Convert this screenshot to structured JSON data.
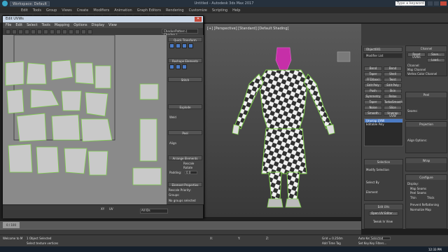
{
  "app": {
    "workspace": "Workspace: Default",
    "title": "Untitled - Autodesk 3ds Max 2017",
    "search_placeholder": "Type a keyword or phrase"
  },
  "menu": [
    "Edit",
    "Tools",
    "Group",
    "Views",
    "Create",
    "Modifiers",
    "Animation",
    "Graph Editors",
    "Rendering",
    "Customize",
    "Scripting",
    "Help"
  ],
  "unwrap": {
    "title": "Edit UVWs",
    "menu": [
      "File",
      "Edit",
      "Select",
      "Tools",
      "Mapping",
      "Options",
      "Display",
      "View"
    ],
    "checker": "CheckerPattern ( Checker )",
    "panel": {
      "quick_transform": "Quick Transform",
      "reshape": "Reshape Elements",
      "stitch": "Stitch",
      "explode": "Explode",
      "weld": "Weld",
      "peel": "Peel",
      "align": "Align",
      "arrange": "Arrange Elements",
      "rescale": "Rescale",
      "rotate": "Rotate",
      "padding": "Padding:",
      "padding_value": "0.0",
      "element_props": "Element Properties",
      "rescale_priority": "Rescale Priority:",
      "groups": "Groups:",
      "no_groups": "No groups selected"
    },
    "bottom": {
      "xy": "XY",
      "uv": "UV",
      "all_ids": "All IDs"
    }
  },
  "viewport": {
    "label": "[+] [Perspective] [Standard] [Default Shading]"
  },
  "command_panel": {
    "object_name": "Object001",
    "modifier_list": "Modifier List",
    "buttons": [
      [
        "Bend",
        "Bend"
      ],
      [
        "Taper",
        "Shell"
      ],
      [
        "FFD(box)",
        "Twist"
      ],
      [
        "Edit Poly",
        "Edit Poly"
      ],
      [
        "Push",
        "Skin"
      ],
      [
        "Symmetry",
        "Relax"
      ],
      [
        "Taper",
        "TurboSmooth"
      ],
      [
        "Noise",
        "Slice"
      ],
      [
        "Smooth",
        "Unwrap UVW"
      ]
    ],
    "stack": [
      "Unwrap UVW",
      "Editable Poly"
    ],
    "selection": "Selection",
    "modify_selection": "Modify Selection",
    "select_by": "Select By",
    "element": "Element",
    "edit_uvs": "Edit UVs",
    "open_uv_editor": "Open UV Editor ...",
    "tweak_in_view": "Tweak In View",
    "wrap": "Wrap",
    "channel": {
      "title": "Channel",
      "reset": "Reset UVWs",
      "save": "Save...",
      "load": "Load...",
      "channel_label": "Channel:",
      "map": "Map Channel",
      "vertex": "Vertex Color Channel"
    },
    "peel": {
      "title": "Peel",
      "seams": "Seams:"
    },
    "projection": {
      "title": "Projection",
      "align": "Align Options:"
    },
    "configure": {
      "title": "Configure",
      "display": "Display:",
      "map_seams": "Map Seams",
      "peel_seams": "Peel Seams",
      "thin": "Thin",
      "thick": "Thick",
      "prevent": "Prevent Reflattening",
      "normalize": "Normalize Map"
    }
  },
  "timeline": {
    "frame": "0 / 100"
  },
  "status": {
    "selected": "1 Object Selected",
    "prompt": "Select texture vertices",
    "welcome": "Welcome to M",
    "x": "X:",
    "y": "Y:",
    "z": "Z:",
    "grid": "Grid = 0.254m",
    "auto_key": "Auto Key",
    "selected_btn": "Selected",
    "set_key": "Set Key",
    "filters": "Key Filters...",
    "add_time_tag": "Add Time Tag"
  },
  "taskbar": {
    "time": "12:33 PM"
  },
  "colors": {
    "accent": "#4b7bc4",
    "checker_dark": "#333333",
    "checker_light": "#f0f0f0",
    "seam": "#7ecf4a",
    "head": "#c62fa8"
  }
}
